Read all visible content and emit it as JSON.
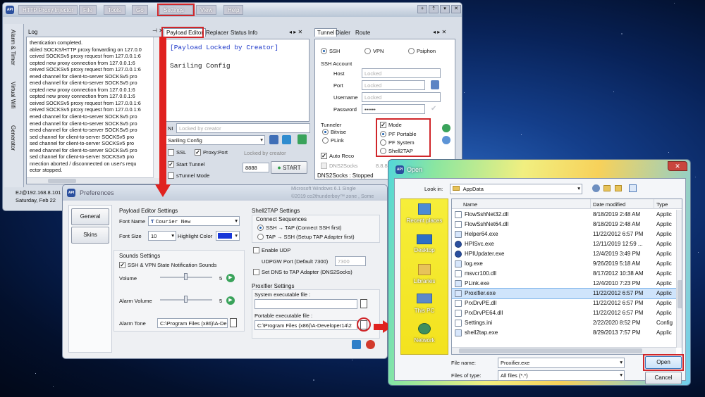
{
  "main_window": {
    "title": "HTTP Proxy Injector",
    "menu": [
      "File",
      "Tools",
      "Go",
      "Settings",
      "View",
      "Help"
    ],
    "side_tabs": [
      "Alarm & Timer",
      "Virtual Wifi",
      "Generator"
    ],
    "log": {
      "title": "Log",
      "lines": [
        "thentication completed.",
        "abled SOCKS/HTTP proxy forwarding on 127.0.0",
        "ceived SOCKSv5 proxy request from 127.0.0.1:6",
        "cepted new proxy connection from 127.0.0.1:6",
        "ceived SOCKSv5 proxy request from 127.0.0.1:6",
        "ened channel for client-to-server SOCKSv5 pro",
        "ened channel for client-to-server SOCKSv5 pro",
        "cepted new proxy connection from 127.0.0.1:6",
        "cepted new proxy connection from 127.0.0.1:6",
        "ceived SOCKSv5 proxy request from 127.0.0.1:6",
        "ceived SOCKSv5 proxy request from 127.0.0.1:6",
        "ened channel for client-to-server SOCKSv5 pro",
        "ened channel for client-to-server SOCKSv5 pro",
        "ened channel for client-to-server SOCKSv5 pro",
        "sed channel for client-to-server SOCKSv5 pro",
        "sed channel for client-to-server SOCKSv5 pro",
        "ened channel for client-to-server SOCKSv5 pro",
        "sed channel for client-to-server SOCKSv5 pro",
        "nnection aborted / disconnected on user's requ",
        "ector stopped."
      ]
    },
    "editor_tabs": [
      "Payload Editor",
      "Replacer",
      "Status Info"
    ],
    "payload_text": "[Payload Locked by Creator]",
    "config_text": "Sariling Config",
    "sni_label": "NI",
    "sni_placeholder": "Locked by creator",
    "config_select": "Sariling Config",
    "ssl_label": "SSL",
    "proxy_port_label": "Proxy:Port",
    "proxy_port_value": "Locked by creator",
    "start_tunnel_label": "Start Tunnel",
    "stunnel_mode_label": "sTunnel Mode",
    "port_value": "8888",
    "start_button": "START",
    "right_tabs": [
      "Tunnel",
      "Dialer",
      "Route"
    ],
    "protocols": [
      "SSH",
      "VPN",
      "Psiphon"
    ],
    "ssh_account": {
      "title": "SSH Account",
      "host_label": "Host",
      "host_value": "Locked",
      "port_label": "Port",
      "port_value": "Locked",
      "username_label": "Username",
      "username_value": "Locked",
      "password_label": "Password",
      "password_value": "••••••"
    },
    "tunneler": {
      "title": "Tunneler",
      "options": [
        "Bitvise",
        "PLink"
      ]
    },
    "mode": {
      "title": "Mode",
      "options": [
        "PF Portable",
        "PF System",
        "Shell2TAP"
      ]
    },
    "auto_reco_label": "Auto Reco",
    "dns2socks_label": "DNS2Socks",
    "dns_value": "8.8.8.8:53",
    "dns2socks_status": "DNS2Socks : Stopped",
    "status_ip": "EJ@192.168.8.101",
    "status_date": "Saturday, Feb 22"
  },
  "preferences": {
    "title": "Preferences",
    "nav": [
      "General",
      "Skins"
    ],
    "payload_editor": {
      "title": "Payload Editor Settings",
      "font_name_label": "Font Name",
      "font_name_value": "Courier New",
      "font_size_label": "Font Size",
      "font_size_value": "10",
      "highlight_color_label": "Highlight Color",
      "highlight_color": "#1737d8"
    },
    "sounds": {
      "title": "Sounds Settings",
      "notification_label": "SSH & VPN State Notification Sounds",
      "volume_label": "Volume",
      "volume_value": "5",
      "volume_level": 0.5,
      "alarm_volume_label": "Alarm Volume",
      "alarm_volume_value": "5",
      "alarm_volume_level": 0.5,
      "alarm_tone_label": "Alarm Tone",
      "alarm_tone_value": "C:\\Program Files (x86)\\A-De"
    },
    "shell2tap": {
      "title": "Shell2TAP Settings",
      "connect_sequences_title": "Connect Sequences",
      "seq1": "SSH → TAP (Connect SSH first)",
      "seq2": "TAP → SSH (Setup TAP Adapter first)",
      "enable_udp_label": "Enable UDP",
      "udpgw_label": "UDPGW Port (Default 7300)",
      "udpgw_value": "7300",
      "set_dns_label": "Set DNS to TAP Adapter (DNS2Socks)"
    },
    "proxifier": {
      "title": "Proxifier Settings",
      "system_label": "System executable file :",
      "system_value": "",
      "portable_label": "Portable executable file :",
      "portable_value": "C:\\Program Files (x86)\\A-Developer14\\2"
    },
    "watermark_1": "Microsoft Windows 6.1 Single",
    "watermark_2": "©2019  co2thunderboy™ zone , Some"
  },
  "open_dialog": {
    "title": "Open",
    "look_in_label": "Look in:",
    "look_in_value": "AppData",
    "places": [
      "Recent places",
      "Desktop",
      "Libraries",
      "This PC",
      "Network"
    ],
    "columns": [
      "Name",
      "Date modified",
      "Type"
    ],
    "files": [
      {
        "name": "FlowSshNet32.dll",
        "date": "8/18/2019 2:48 AM",
        "type": "Applic",
        "icon": "dll-icon"
      },
      {
        "name": "FlowSshNet64.dll",
        "date": "8/18/2019 2:48 AM",
        "type": "Applic",
        "icon": "dll-icon"
      },
      {
        "name": "Helper64.exe",
        "date": "11/22/2012 6:57 PM",
        "type": "Applic",
        "icon": "exe-icon"
      },
      {
        "name": "HPISvc.exe",
        "date": "12/11/2019 12:59 ...",
        "type": "Applic",
        "icon": "app-icon"
      },
      {
        "name": "HPIUpdater.exe",
        "date": "12/4/2019 3:49 PM",
        "type": "Applic",
        "icon": "app-icon"
      },
      {
        "name": "log.exe",
        "date": "9/26/2019 5:18 AM",
        "type": "Applic",
        "icon": "exe-icon"
      },
      {
        "name": "msvcr100.dll",
        "date": "8/17/2012 10:38 AM",
        "type": "Applic",
        "icon": "dll-icon"
      },
      {
        "name": "PLink.exe",
        "date": "12/4/2010 7:23 PM",
        "type": "Applic",
        "icon": "exe-icon"
      },
      {
        "name": "Proxifier.exe",
        "date": "11/22/2012 6:57 PM",
        "type": "Applic",
        "icon": "exe-icon"
      },
      {
        "name": "PrxDrvPE.dll",
        "date": "11/22/2012 6:57 PM",
        "type": "Applic",
        "icon": "dll-icon"
      },
      {
        "name": "PrxDrvPE64.dll",
        "date": "11/22/2012 6:57 PM",
        "type": "Applic",
        "icon": "dll-icon"
      },
      {
        "name": "Settings.ini",
        "date": "2/22/2020 8:52 PM",
        "type": "Config",
        "icon": "ini-icon"
      },
      {
        "name": "shell2tap.exe",
        "date": "8/29/2013 7:57 PM",
        "type": "Applic",
        "icon": "exe-icon"
      }
    ],
    "selected_file": "Proxifier.exe",
    "file_name_label": "File name:",
    "file_name_value": "Proxifier.exe",
    "file_type_label": "Files of type:",
    "file_type_value": "All files (*.*)",
    "open_button": "Open",
    "cancel_button": "Cancel",
    "highlight_color": "#d0262a"
  }
}
